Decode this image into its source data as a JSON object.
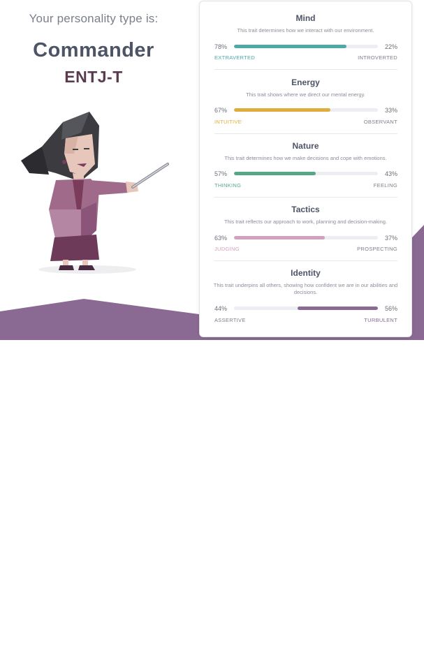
{
  "heading": {
    "intro": "Your personality type is:",
    "type_name": "Commander",
    "type_code": "ENTJ-T"
  },
  "colors": {
    "background_accent": "#8a6a93",
    "mind": "#4fa9a6",
    "energy": "#e0ad3c",
    "nature": "#55a887",
    "tactics": "#d3a0bd",
    "identity": "#8a6a93"
  },
  "traits": [
    {
      "title": "Mind",
      "description": "This trait determines how we interact with our environment.",
      "left_pct": "78%",
      "right_pct": "22%",
      "left_label": "EXTRAVERTED",
      "right_label": "INTROVERTED",
      "dominant": "left",
      "value": 0.78,
      "color": "#4fa9a6"
    },
    {
      "title": "Energy",
      "description": "This trait shows where we direct our mental energy.",
      "left_pct": "67%",
      "right_pct": "33%",
      "left_label": "INTUITIVE",
      "right_label": "OBSERVANT",
      "dominant": "left",
      "value": 0.67,
      "color": "#e0ad3c"
    },
    {
      "title": "Nature",
      "description": "This trait determines how we make decisions and cope with emotions.",
      "left_pct": "57%",
      "right_pct": "43%",
      "left_label": "THINKING",
      "right_label": "FEELING",
      "dominant": "left",
      "value": 0.57,
      "color": "#55a887"
    },
    {
      "title": "Tactics",
      "description": "This trait reflects our approach to work, planning and decision-making.",
      "left_pct": "63%",
      "right_pct": "37%",
      "left_label": "JUDGING",
      "right_label": "PROSPECTING",
      "dominant": "left",
      "value": 0.63,
      "color": "#d3a0bd"
    },
    {
      "title": "Identity",
      "description": "This trait underpins all others, showing how confident we are in our abilities and decisions.",
      "left_pct": "44%",
      "right_pct": "56%",
      "left_label": "ASSERTIVE",
      "right_label": "TURBULENT",
      "dominant": "right",
      "value": 0.56,
      "color": "#8a6a93"
    }
  ]
}
